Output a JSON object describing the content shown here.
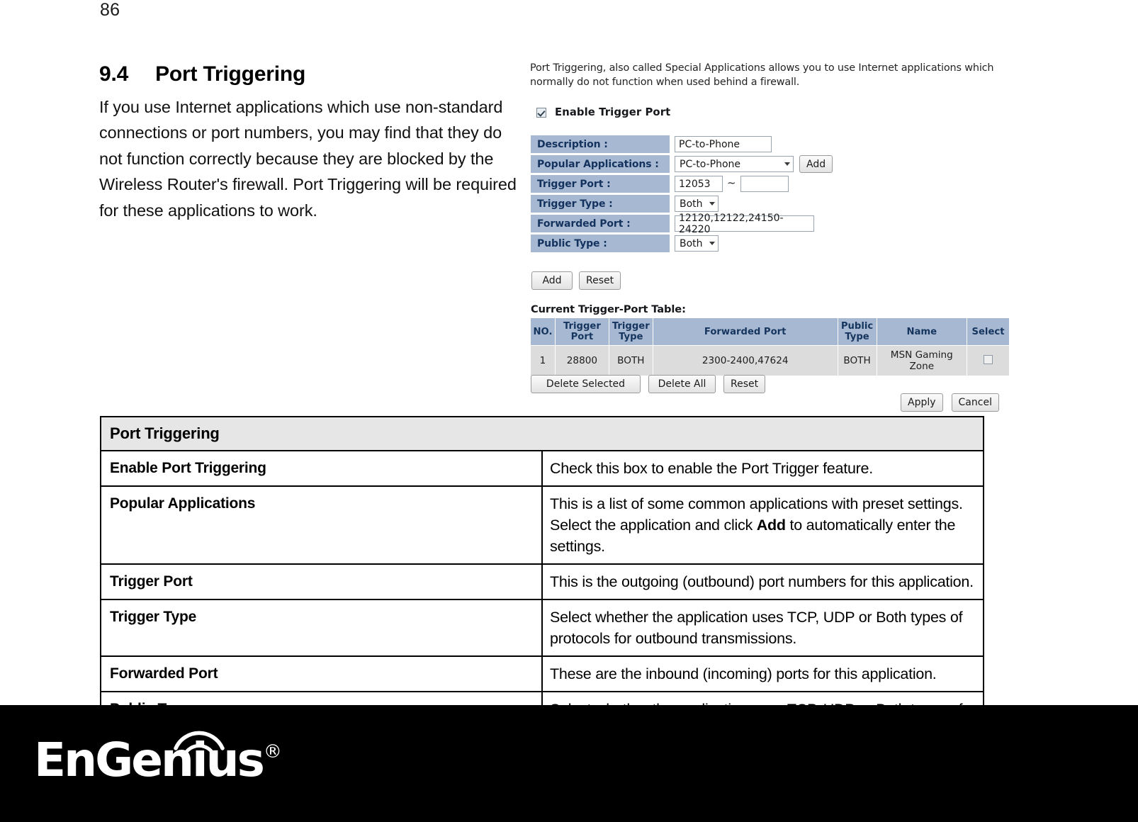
{
  "page": {
    "number": "86"
  },
  "section": {
    "number": "9.4",
    "title": "Port Triggering",
    "paragraph": "If you use Internet applications which use non-standard connections or port numbers, you may find that they do not function correctly because they are blocked by the Wireless Router's firewall. Port Triggering will be required for these applications to work."
  },
  "router_ui": {
    "blurb": "Port Triggering, also called Special Applications allows you to use Internet applications which normally do not function when used behind a firewall.",
    "enable": {
      "label": "Enable Trigger Port",
      "checked": "true"
    },
    "form": {
      "description": {
        "label": "Description :",
        "value": "PC-to-Phone"
      },
      "popular_applications": {
        "label": "Popular Applications :",
        "value": "PC-to-Phone",
        "add_button": "Add"
      },
      "trigger_port": {
        "label": "Trigger Port :",
        "value_from": "12053",
        "separator": "~",
        "value_to": ""
      },
      "trigger_type": {
        "label": "Trigger Type :",
        "value": "Both"
      },
      "forwarded_port": {
        "label": "Forwarded Port :",
        "value": "12120,12122,24150-24220"
      },
      "public_type": {
        "label": "Public Type :",
        "value": "Both"
      }
    },
    "form_actions": {
      "add": "Add",
      "reset": "Reset"
    },
    "table": {
      "title": "Current Trigger-Port Table:",
      "headers": [
        "NO.",
        "Trigger Port",
        "Trigger Type",
        "Forwarded Port",
        "Public Type",
        "Name",
        "Select"
      ],
      "rows": [
        {
          "no": "1",
          "trigger_port": "28800",
          "trigger_type": "BOTH",
          "forwarded_port": "2300-2400,47624",
          "public_type": "BOTH",
          "name": "MSN Gaming Zone",
          "select_checked": "false"
        }
      ]
    },
    "table_actions": {
      "delete_selected": "Delete Selected",
      "delete_all": "Delete All",
      "reset": "Reset"
    },
    "page_actions": {
      "apply": "Apply",
      "cancel": "Cancel"
    },
    "colors": {
      "label_blue": "#a7b9d2",
      "label_text": "#14325e",
      "table_row_gray": "#dcdcdc"
    }
  },
  "desc_table": {
    "header": "Port Triggering",
    "rows": [
      {
        "term": "Enable Port Triggering",
        "lines": [
          "Check this box to enable the Port Trigger feature."
        ]
      },
      {
        "term": "Popular Applications",
        "lines": [
          "This is a list of some common applications with preset settings."
        ],
        "line2_pre": "Select the application and click ",
        "line2_bold": "Add",
        "line2_post": " to automatically enter the settings."
      },
      {
        "term": "Trigger Port",
        "lines": [
          "This is the outgoing (outbound) port numbers for this application."
        ]
      },
      {
        "term": "Trigger Type",
        "lines": [
          "Select whether the application uses TCP, UDP or Both types of protocols for outbound transmissions."
        ]
      },
      {
        "term": "Forwarded Port",
        "lines": [
          "These are the inbound (incoming) ports for this application."
        ]
      },
      {
        "term": "Public Type",
        "lines": [
          "Select whether the application uses TCP, UDP or Both types of protocols for inbound transmissions."
        ]
      }
    ]
  },
  "footer": {
    "brand": "EnGenius",
    "registered_mark": "®"
  }
}
